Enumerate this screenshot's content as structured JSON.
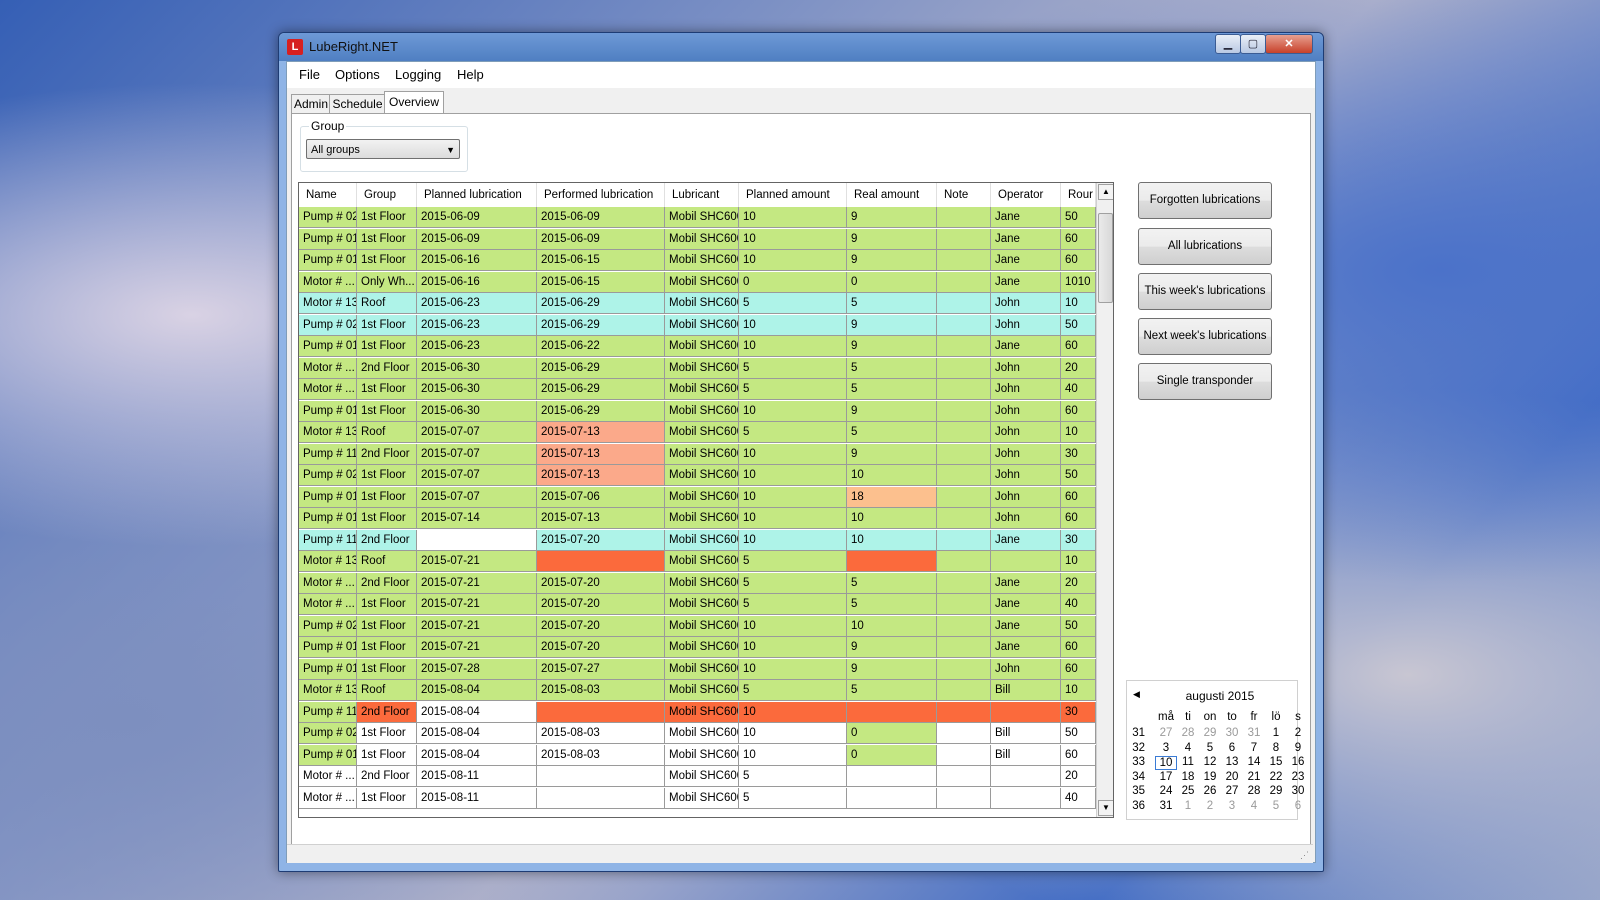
{
  "window": {
    "title": "LubeRight.NET",
    "minimize": "▁",
    "maximize": "▢",
    "close": "✕"
  },
  "menu": [
    "File",
    "Options",
    "Logging",
    "Help"
  ],
  "tabs": [
    "Admin",
    "Schedule",
    "Overview"
  ],
  "group_filter": {
    "label": "Group",
    "value": "All groups"
  },
  "table": {
    "columns": [
      "Name",
      "Group",
      "Planned lubrication",
      "Performed lubrication",
      "Lubricant",
      "Planned amount",
      "Real amount",
      "Note",
      "Operator",
      "Rour"
    ],
    "rows": [
      {
        "c": [
          "Pump # 02",
          "1st Floor",
          "2015-06-09",
          "2015-06-09",
          "Mobil SHC600",
          "10",
          "9",
          "",
          "Jane",
          "50"
        ],
        "bg": "green"
      },
      {
        "c": [
          "Pump # 01",
          "1st Floor",
          "2015-06-09",
          "2015-06-09",
          "Mobil SHC600",
          "10",
          "9",
          "",
          "Jane",
          "60"
        ],
        "bg": "green"
      },
      {
        "c": [
          "Pump # 01",
          "1st Floor",
          "2015-06-16",
          "2015-06-15",
          "Mobil SHC600",
          "10",
          "9",
          "",
          "Jane",
          "60"
        ],
        "bg": "green"
      },
      {
        "c": [
          "Motor # ...",
          "Only Wh...",
          "2015-06-16",
          "2015-06-15",
          "Mobil SHC600",
          "0",
          "0",
          "",
          "Jane",
          "1010"
        ],
        "bg": "green"
      },
      {
        "c": [
          "Motor # 13",
          "Roof",
          "2015-06-23",
          "2015-06-29",
          "Mobil SHC600",
          "5",
          "5",
          "",
          "John",
          "10"
        ],
        "bg": "cyan"
      },
      {
        "c": [
          "Pump # 02",
          "1st Floor",
          "2015-06-23",
          "2015-06-29",
          "Mobil SHC600",
          "10",
          "9",
          "",
          "John",
          "50"
        ],
        "bg": "cyan"
      },
      {
        "c": [
          "Pump # 01",
          "1st Floor",
          "2015-06-23",
          "2015-06-22",
          "Mobil SHC600",
          "10",
          "9",
          "",
          "Jane",
          "60"
        ],
        "bg": "green"
      },
      {
        "c": [
          "Motor # ...",
          "2nd Floor",
          "2015-06-30",
          "2015-06-29",
          "Mobil SHC600",
          "5",
          "5",
          "",
          "John",
          "20"
        ],
        "bg": "green"
      },
      {
        "c": [
          "Motor # ...",
          "1st Floor",
          "2015-06-30",
          "2015-06-29",
          "Mobil SHC600",
          "5",
          "5",
          "",
          "John",
          "40"
        ],
        "bg": "green"
      },
      {
        "c": [
          "Pump # 01",
          "1st Floor",
          "2015-06-30",
          "2015-06-29",
          "Mobil SHC600",
          "10",
          "9",
          "",
          "John",
          "60"
        ],
        "bg": "green"
      },
      {
        "c": [
          "Motor # 13",
          "Roof",
          "2015-07-07",
          "2015-07-13",
          "Mobil SHC600",
          "5",
          "5",
          "",
          "John",
          "10"
        ],
        "bg": "green",
        "hl": {
          "3": "salmon"
        }
      },
      {
        "c": [
          "Pump # 11",
          "2nd Floor",
          "2015-07-07",
          "2015-07-13",
          "Mobil SHC600",
          "10",
          "9",
          "",
          "John",
          "30"
        ],
        "bg": "green",
        "hl": {
          "3": "salmon"
        }
      },
      {
        "c": [
          "Pump # 02",
          "1st Floor",
          "2015-07-07",
          "2015-07-13",
          "Mobil SHC600",
          "10",
          "10",
          "",
          "John",
          "50"
        ],
        "bg": "green",
        "hl": {
          "3": "salmon"
        }
      },
      {
        "c": [
          "Pump # 01",
          "1st Floor",
          "2015-07-07",
          "2015-07-06",
          "Mobil SHC600",
          "10",
          "18",
          "",
          "John",
          "60"
        ],
        "bg": "green",
        "hl": {
          "6": "peach"
        }
      },
      {
        "c": [
          "Pump # 01",
          "1st Floor",
          "2015-07-14",
          "2015-07-13",
          "Mobil SHC600",
          "10",
          "10",
          "",
          "John",
          "60"
        ],
        "bg": "green"
      },
      {
        "c": [
          "Pump # 11",
          "2nd Floor",
          "",
          "2015-07-20",
          "Mobil SHC600",
          "10",
          "10",
          "",
          "Jane",
          "30"
        ],
        "bg": "cyan",
        "hl": {
          "2": "white"
        }
      },
      {
        "c": [
          "Motor # 13",
          "Roof",
          "2015-07-21",
          "",
          "Mobil SHC600",
          "5",
          "",
          "",
          "",
          "10"
        ],
        "bg": "green",
        "hl": {
          "3": "red",
          "6": "red"
        }
      },
      {
        "c": [
          "Motor # ...",
          "2nd Floor",
          "2015-07-21",
          "2015-07-20",
          "Mobil SHC600",
          "5",
          "5",
          "",
          "Jane",
          "20"
        ],
        "bg": "green"
      },
      {
        "c": [
          "Motor # ...",
          "1st Floor",
          "2015-07-21",
          "2015-07-20",
          "Mobil SHC600",
          "5",
          "5",
          "",
          "Jane",
          "40"
        ],
        "bg": "green"
      },
      {
        "c": [
          "Pump # 02",
          "1st Floor",
          "2015-07-21",
          "2015-07-20",
          "Mobil SHC600",
          "10",
          "10",
          "",
          "Jane",
          "50"
        ],
        "bg": "green"
      },
      {
        "c": [
          "Pump # 01",
          "1st Floor",
          "2015-07-21",
          "2015-07-20",
          "Mobil SHC600",
          "10",
          "9",
          "",
          "Jane",
          "60"
        ],
        "bg": "green"
      },
      {
        "c": [
          "Pump # 01",
          "1st Floor",
          "2015-07-28",
          "2015-07-27",
          "Mobil SHC600",
          "10",
          "9",
          "",
          "John",
          "60"
        ],
        "bg": "green"
      },
      {
        "c": [
          "Motor # 13",
          "Roof",
          "2015-08-04",
          "2015-08-03",
          "Mobil SHC600",
          "5",
          "5",
          "",
          "Bill",
          "10"
        ],
        "bg": "green"
      },
      {
        "c": [
          "Pump # 11",
          "2nd Floor",
          "2015-08-04",
          "",
          "Mobil SHC600",
          "10",
          "",
          "",
          "",
          "30"
        ],
        "bg": "red",
        "hl": {
          "0": "green",
          "2": "white"
        }
      },
      {
        "c": [
          "Pump # 02",
          "1st Floor",
          "2015-08-04",
          "2015-08-03",
          "Mobil SHC600",
          "10",
          "0",
          "",
          "Bill",
          "50"
        ],
        "bg": "white",
        "hl": {
          "0": "green",
          "6": "green"
        }
      },
      {
        "c": [
          "Pump # 01",
          "1st Floor",
          "2015-08-04",
          "2015-08-03",
          "Mobil SHC600",
          "10",
          "0",
          "",
          "Bill",
          "60"
        ],
        "bg": "white",
        "hl": {
          "0": "green",
          "6": "green"
        }
      },
      {
        "c": [
          "Motor # ...",
          "2nd Floor",
          "2015-08-11",
          "",
          "Mobil SHC600",
          "5",
          "",
          "",
          "",
          "20"
        ],
        "bg": "white"
      },
      {
        "c": [
          "Motor # ...",
          "1st Floor",
          "2015-08-11",
          "",
          "Mobil SHC600",
          "5",
          "",
          "",
          "",
          "40"
        ],
        "bg": "white"
      }
    ]
  },
  "actions": [
    "Forgotten lubrications",
    "All lubrications",
    "This week's lubrications",
    "Next week's lubrications",
    "Single transponder"
  ],
  "calendar": {
    "title": "augusti 2015",
    "prev": "◀",
    "days": [
      "må",
      "ti",
      "on",
      "to",
      "fr",
      "lö",
      "s"
    ],
    "weeks": [
      {
        "wk": "31",
        "d": [
          [
            "27",
            1
          ],
          [
            "28",
            1
          ],
          [
            "29",
            1
          ],
          [
            "30",
            1
          ],
          [
            "31",
            1
          ],
          [
            "1",
            0
          ],
          [
            "2",
            0
          ]
        ]
      },
      {
        "wk": "32",
        "d": [
          [
            "3",
            0
          ],
          [
            "4",
            0
          ],
          [
            "5",
            0
          ],
          [
            "6",
            0
          ],
          [
            "7",
            0
          ],
          [
            "8",
            0
          ],
          [
            "9",
            0
          ]
        ]
      },
      {
        "wk": "33",
        "d": [
          [
            "10",
            0
          ],
          [
            "11",
            0
          ],
          [
            "12",
            0
          ],
          [
            "13",
            0
          ],
          [
            "14",
            0
          ],
          [
            "15",
            0
          ],
          [
            "16",
            0
          ]
        ]
      },
      {
        "wk": "34",
        "d": [
          [
            "17",
            0
          ],
          [
            "18",
            0
          ],
          [
            "19",
            0
          ],
          [
            "20",
            0
          ],
          [
            "21",
            0
          ],
          [
            "22",
            0
          ],
          [
            "23",
            0
          ]
        ]
      },
      {
        "wk": "35",
        "d": [
          [
            "24",
            0
          ],
          [
            "25",
            0
          ],
          [
            "26",
            0
          ],
          [
            "27",
            0
          ],
          [
            "28",
            0
          ],
          [
            "29",
            0
          ],
          [
            "30",
            0
          ]
        ]
      },
      {
        "wk": "36",
        "d": [
          [
            "31",
            0
          ],
          [
            "1",
            1
          ],
          [
            "2",
            1
          ],
          [
            "3",
            1
          ],
          [
            "4",
            1
          ],
          [
            "5",
            1
          ],
          [
            "6",
            1
          ]
        ]
      }
    ],
    "today": "10"
  },
  "colors": {
    "green": "#c4e882",
    "cyan": "#aef3e8",
    "salmon": "#fba98a",
    "peach": "#fcc08e",
    "red": "#fb6a3c",
    "white": "#ffffff"
  },
  "icons": {
    "dropdown": "▼",
    "scroll_up": "▲",
    "scroll_down": "▼",
    "grip": "⋰",
    "app": "L"
  }
}
